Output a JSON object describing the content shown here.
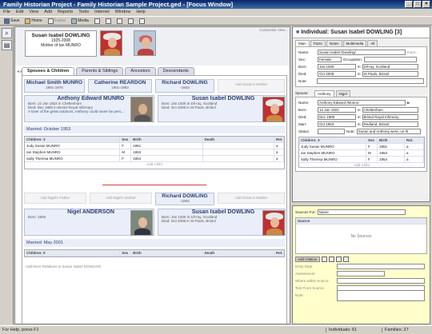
{
  "window": {
    "title": "Family Historian Project - Family Historian Sample Project.ged - [Focus Window]",
    "buttons": [
      "_",
      "□",
      "×"
    ]
  },
  "menu": [
    "File",
    "Edit",
    "View",
    "Add",
    "Reports",
    "Tools",
    "Internet",
    "Window",
    "Help"
  ],
  "toolbar": {
    "save": "Save",
    "home": "Home",
    "frame": "Frame",
    "media": "Media"
  },
  "focus": {
    "customise": "Customise View...",
    "selected": {
      "name": "Susan Isabel DOWLING",
      "dates": "1925-2008",
      "relation": "Mother of Ian MUNRO"
    },
    "tabs": [
      "Spouses & Children",
      "Parents & Siblings",
      "Ancestors",
      "Descendants"
    ],
    "father1": {
      "name": "Michael Smith MUNRO",
      "dates": "1891-1978"
    },
    "mother1": {
      "name": "Catherine REARDON",
      "dates": "1901-1983"
    },
    "father2": {
      "name": "Richard DOWLING",
      "dates": "-1943"
    },
    "add_mother1": "Add Susan's Mother",
    "spouse1": {
      "name": "Anthony Edward MUNRO",
      "born": "12 Jan 1922 in Cheltenham",
      "died": "Dec 1980 in Bristol Royal Infirmary",
      "note": "A lover of the great outdoors, Anthony could never be pers..."
    },
    "focus_person": {
      "name": "Susan Isabel DOWLING",
      "born": "Jan 1925 in Dil-ray, Scotland",
      "died": "Oct 2008 in St Pauls, Bristol"
    },
    "marriage1": "Married: October 1953",
    "children1_header": [
      "Children: 3",
      "Sex",
      "Birth",
      "Death",
      "Rel."
    ],
    "children1": [
      {
        "name": "Judy Susan MUNRO",
        "sex": "F",
        "birth": "1951",
        "rel": "a"
      },
      {
        "name": "Ian Stephen MUNRO",
        "sex": "M",
        "birth": "1953",
        "rel": "a"
      },
      {
        "name": "Sally Theresa MUNRO",
        "sex": "F",
        "birth": "1954",
        "rel": "a"
      }
    ],
    "add_child": "Add Child",
    "add_father2": "Add Nigel's Father",
    "add_mother2": "Add Nigel's Mother",
    "father3": {
      "name": "Richard DOWLING",
      "dates": "-1943"
    },
    "add_mother3": "Add Susan's Mother",
    "spouse2": {
      "name": "Nigel ANDERSON",
      "born": "1926"
    },
    "focus_person2": {
      "name": "Susan Isabel DOWLING",
      "born": "Jan 1925 in Dil-ray, Scotland",
      "died": "Oct 2008 in St Pauls, Bristol"
    },
    "marriage2": "Married: May 2001",
    "children2_header": [
      "Children: 0",
      "Sex",
      "Birth",
      "Death",
      "Rel."
    ],
    "add_more": "Add More Relatives to Susan Isabel DOWLING"
  },
  "property": {
    "title": "Individual: Susan Isabel DOWLING [3]",
    "tabs": [
      "Main",
      "Facts",
      "Notes",
      "Multimedia",
      "All"
    ],
    "name_label": "Name:",
    "name_value": "Susan Isabel /Dowling/",
    "more": "more...",
    "sex_label": "Sex:",
    "sex_value": "Female",
    "occ_label": "Occupation:",
    "born_label": "Born:",
    "born_date": "Jan 1925",
    "born_place": "Dil-ray, Scotland",
    "died_label": "Died:",
    "died_date": "Oct 2008",
    "died_place": "St Pauls, Bristol",
    "note_label": "Note:",
    "spouse_label": "Spouse:",
    "spouse_tabs": [
      "Anthony",
      "Nigel"
    ],
    "sp_name": "Anthony Edward /Munro/",
    "sp_born_date": "12 Jan 1922",
    "sp_born_place": "Cheltenham",
    "sp_died_date": "Dec 1980",
    "sp_died_place": "Bristol Royal Infirmary",
    "sp_marr_date": "Oct 1953",
    "sp_marr_place": "Redland, Bristol",
    "status_label": "Status:",
    "sp_note": "Susan and Anthony were, on th",
    "children_header": [
      "Children: 3",
      "Sex",
      "Birth",
      "Rel."
    ],
    "children": [
      {
        "name": "Judy Susan MUNRO",
        "sex": "F",
        "birth": "1951",
        "rel": "a"
      },
      {
        "name": "Ian Stephen MUNRO",
        "sex": "M",
        "birth": "1953",
        "rel": "a"
      },
      {
        "name": "Sally Theresa MUNRO",
        "sex": "F",
        "birth": "1954",
        "rel": "a"
      }
    ],
    "add_child": "Add Child"
  },
  "sources": {
    "label": "Sources For:",
    "select": "Name",
    "col": "Source",
    "empty": "No Sources",
    "add": "Add Citation",
    "fields": [
      "Entry Date:",
      "Assessment:",
      "Where within Source:",
      "Text From Source:",
      "Note:"
    ]
  },
  "status": {
    "help": "For Help, press F1",
    "individuals": "Individuals: 61",
    "families": "Families: 27"
  }
}
